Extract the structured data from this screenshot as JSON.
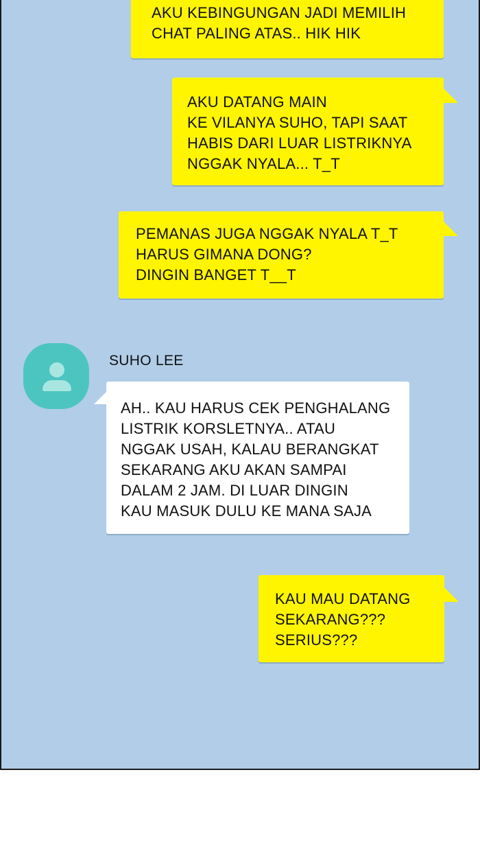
{
  "conversation": {
    "contact_name": "SUHO LEE",
    "contact_avatar_icon": "person-icon",
    "colors": {
      "background": "#b1cde7",
      "outgoing_bubble": "#fff500",
      "incoming_bubble": "#ffffff",
      "avatar": "#4cc5c0"
    },
    "messages": [
      {
        "sender": "me",
        "lines": [
          "AKU KEBINGUNGAN JADI MEMILIH",
          "CHAT PALING ATAS.. HIK HIK"
        ]
      },
      {
        "sender": "me",
        "lines": [
          "AKU DATANG MAIN",
          "KE VILANYA SUHO, TAPI SAAT",
          "HABIS DARI LUAR LISTRIKNYA",
          "NGGAK NYALA... T_T"
        ]
      },
      {
        "sender": "me",
        "lines": [
          "PEMANAS JUGA NGGAK NYALA T_T",
          "HARUS GIMANA DONG?",
          "DINGIN BANGET T__T"
        ]
      },
      {
        "sender": "SUHO LEE",
        "lines": [
          "AH.. KAU HARUS CEK PENGHALANG",
          "LISTRIK KORSLETNYA.. ATAU",
          "NGGAK USAH, KALAU BERANGKAT",
          "SEKARANG AKU AKAN SAMPAI",
          "DALAM 2 JAM. DI LUAR DINGIN",
          "KAU MASUK DULU KE MANA SAJA"
        ]
      },
      {
        "sender": "me",
        "lines": [
          "KAU MAU DATANG",
          "SEKARANG???",
          "SERIUS???"
        ]
      }
    ]
  }
}
